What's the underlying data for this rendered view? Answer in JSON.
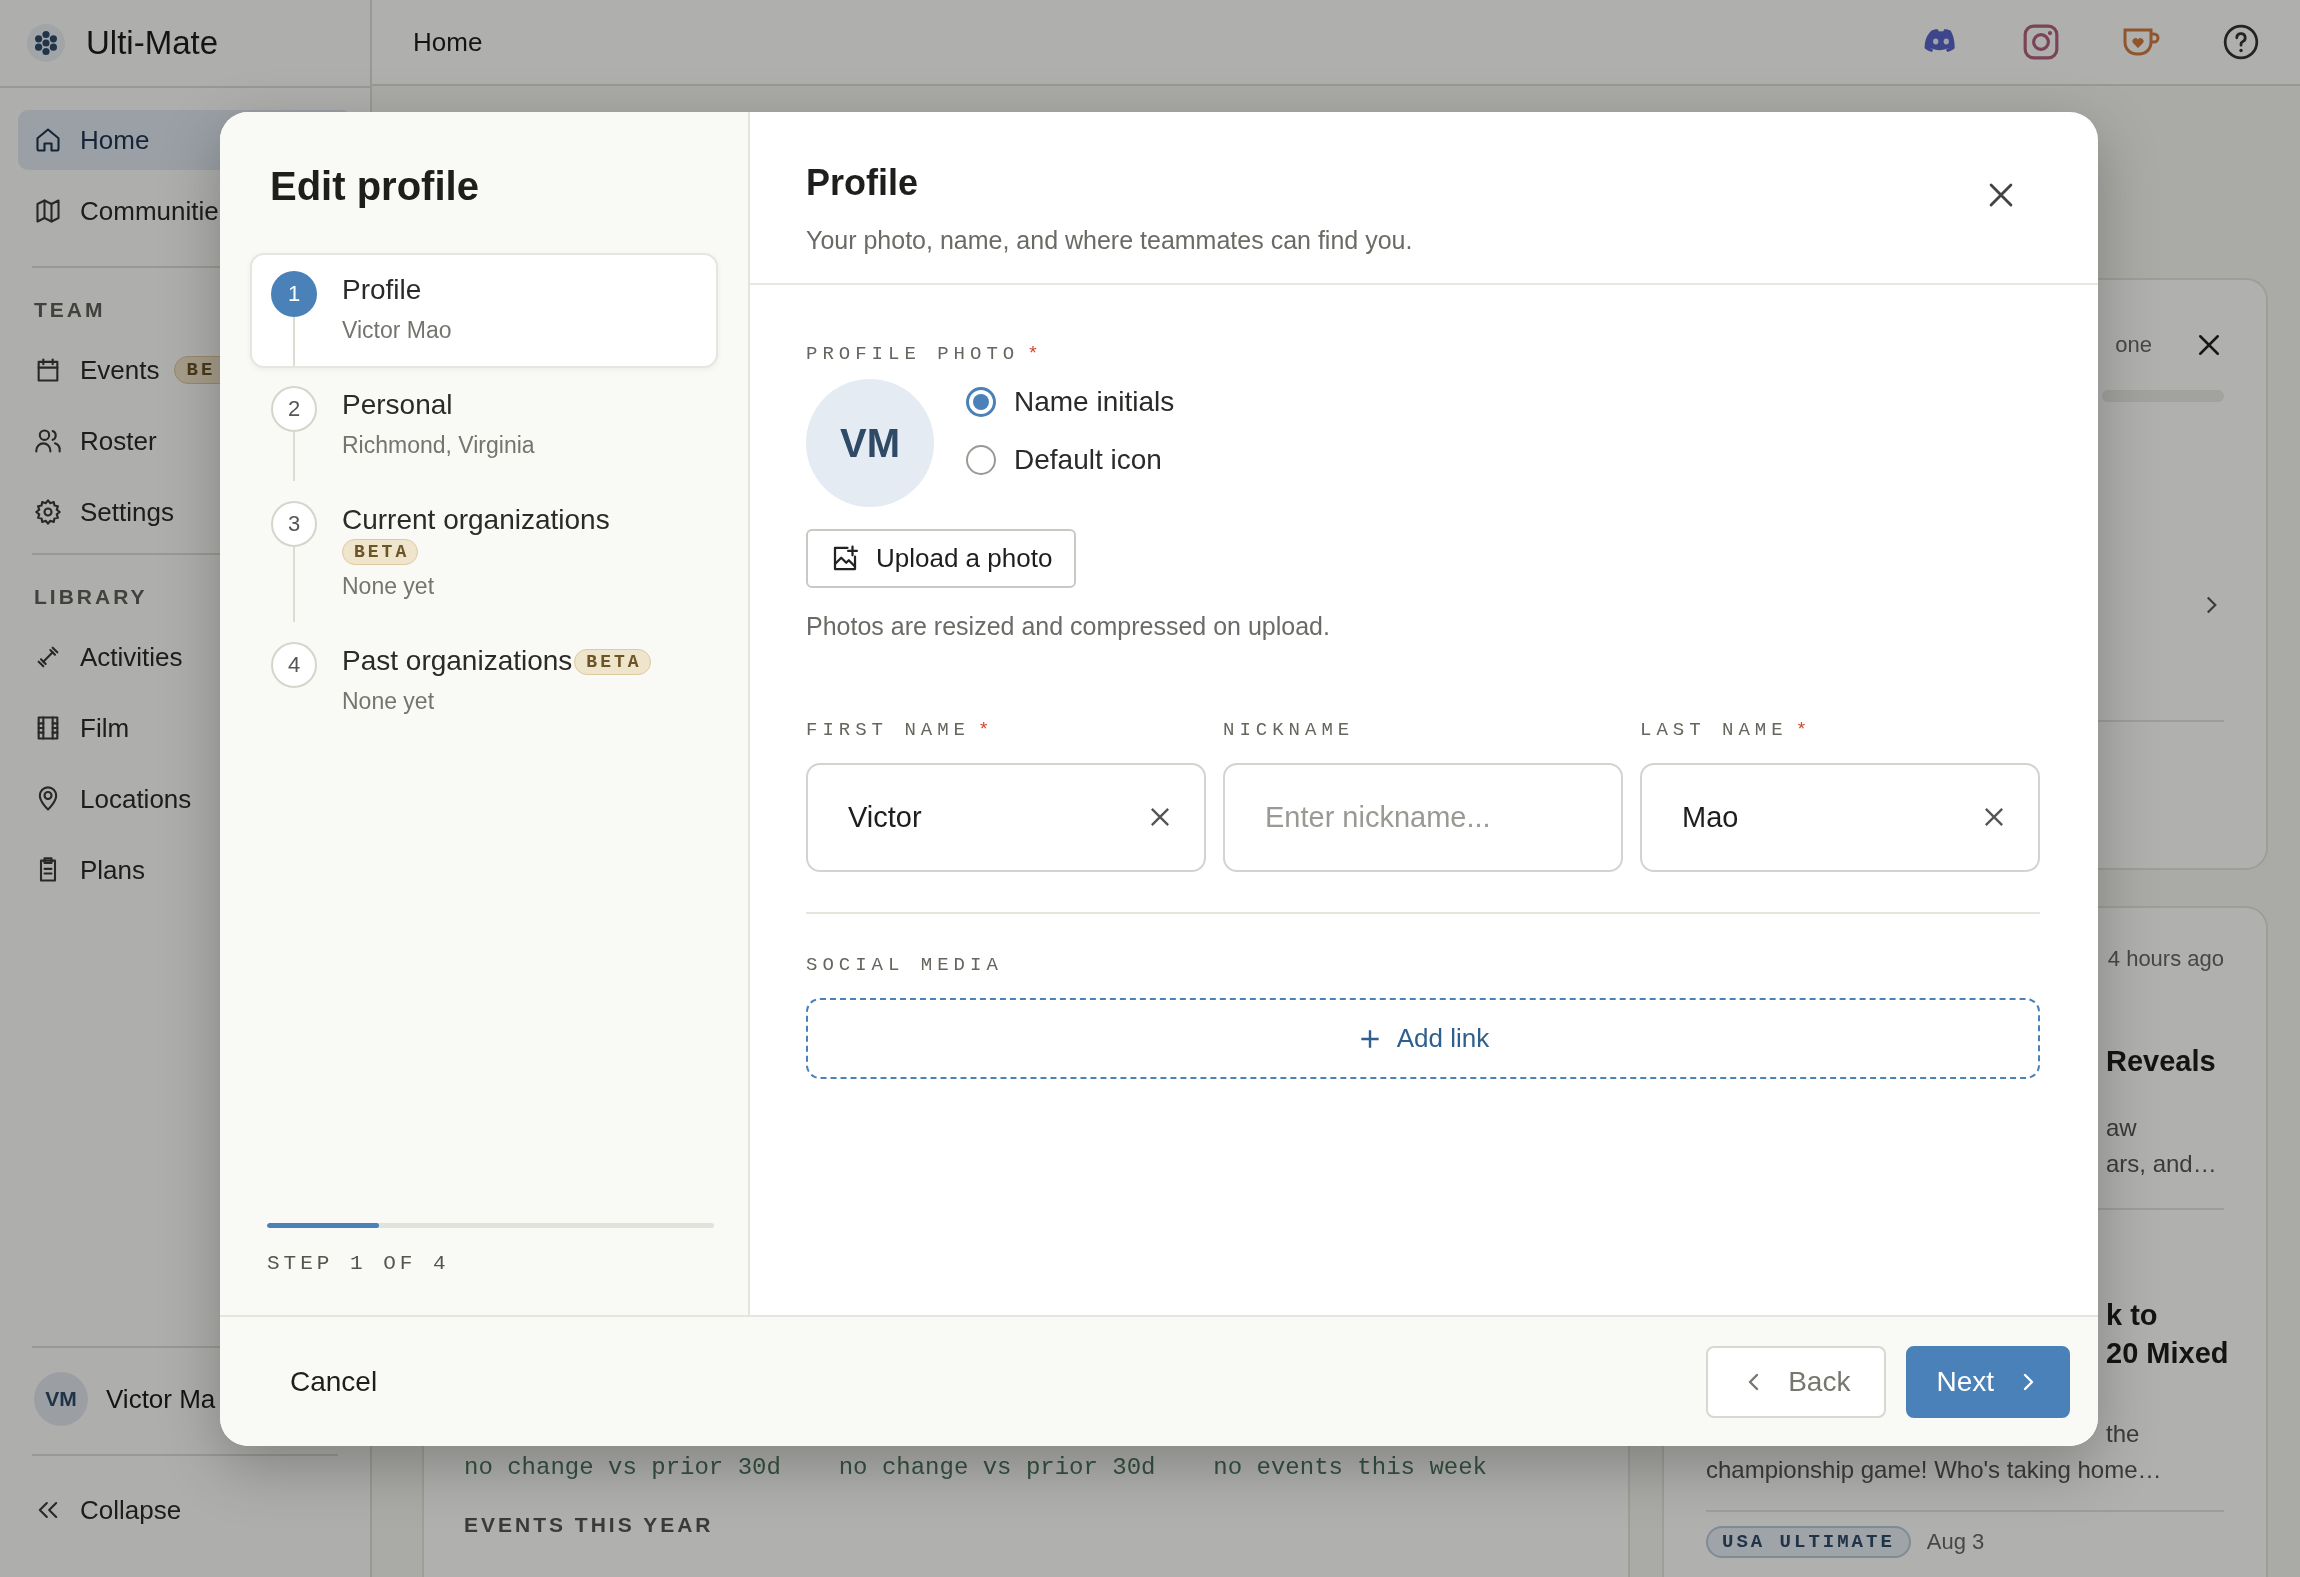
{
  "topbar": {
    "title": "Home"
  },
  "sidebar": {
    "brand": "Ulti-Mate",
    "nav": [
      {
        "label": "Home",
        "selected": true
      },
      {
        "label": "Communitie",
        "selected": false
      }
    ],
    "sections": [
      {
        "heading": "TEAM",
        "items": [
          {
            "label": "Events",
            "badge": "BE",
            "selected": false
          },
          {
            "label": "Roster",
            "selected": false
          },
          {
            "label": "Settings",
            "selected": false
          }
        ]
      },
      {
        "heading": "LIBRARY",
        "items": [
          {
            "label": "Activities",
            "selected": false
          },
          {
            "label": "Film",
            "selected": false
          },
          {
            "label": "Locations",
            "selected": false
          },
          {
            "label": "Plans",
            "selected": false
          }
        ]
      }
    ],
    "user": {
      "initials": "VM",
      "name": "Victor Ma"
    },
    "collapse": "Collapse"
  },
  "background": {
    "stats": [
      "no change vs prior 30d",
      "no change vs prior 30d",
      "no events this week"
    ],
    "section_heading": "EVENTS THIS YEAR",
    "side_card": {
      "status": "one",
      "level": 0
    },
    "news": {
      "time": "4 hours ago",
      "item_1": {
        "title": "Reveals",
        "excerpt": [
          "aw",
          "ars, and…"
        ]
      },
      "item_2": {
        "title": [
          "k to",
          "20 Mixed"
        ],
        "excerpt": [
          "the",
          "championship game! Who's taking home…"
        ]
      },
      "tag": "USA ULTIMATE",
      "date": "Aug 3"
    }
  },
  "modal": {
    "title": "Edit profile",
    "steps": [
      {
        "number": "1",
        "title": "Profile",
        "subtitle": "Victor Mao",
        "selected": true
      },
      {
        "number": "2",
        "title": "Personal",
        "subtitle": "Richmond, Virginia",
        "selected": false
      },
      {
        "number": "3",
        "title": "Current organizations",
        "badge": "BETA",
        "subtitle": "None yet",
        "selected": false
      },
      {
        "number": "4",
        "title": "Past organizations",
        "badge": "BETA",
        "subtitle": "None yet",
        "selected": false
      }
    ],
    "progress": {
      "level": 0.25,
      "label": "STEP 1 OF 4"
    },
    "panel": {
      "title": "Profile",
      "subtitle": "Your photo, name, and where teammates can find you.",
      "photo": {
        "label": "PROFILE PHOTO",
        "required_mark": "*",
        "initials": "VM",
        "options": [
          {
            "label": "Name initials",
            "selected": true
          },
          {
            "label": "Default icon",
            "selected": false
          }
        ],
        "upload": "Upload a photo",
        "hint": "Photos are resized and compressed on upload."
      },
      "name_fields": [
        {
          "label": "FIRST NAME",
          "required_mark": "*",
          "value": "Victor"
        },
        {
          "label": "NICKNAME",
          "placeholder": "Enter nickname..."
        },
        {
          "label": "LAST NAME",
          "required_mark": "*",
          "value": "Mao"
        }
      ],
      "social": {
        "label": "SOCIAL MEDIA",
        "add": "Add link"
      }
    },
    "footer": {
      "cancel": "Cancel",
      "back": "Back",
      "next": "Next"
    }
  }
}
